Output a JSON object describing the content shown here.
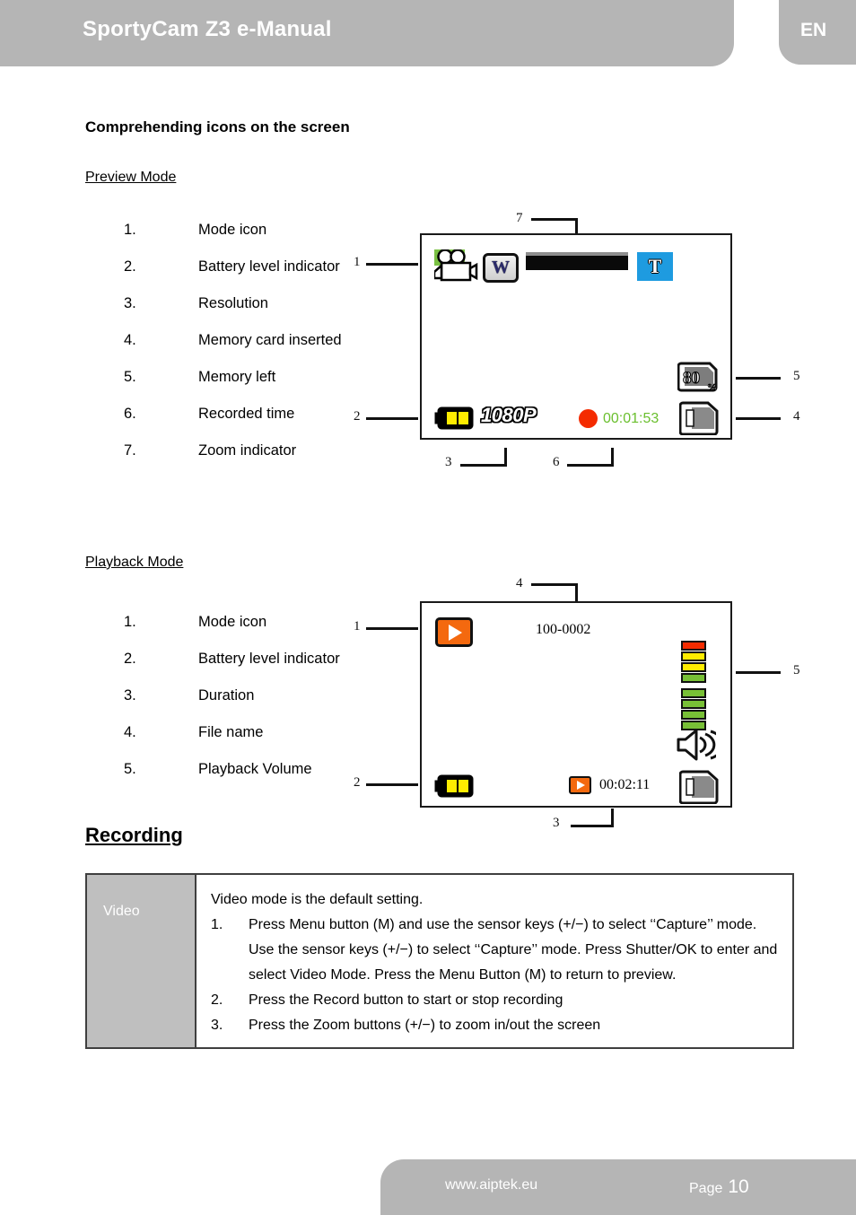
{
  "header": {
    "title": "SportyCam Z3 e-Manual",
    "language": "EN"
  },
  "content": {
    "section_title": "Comprehending icons on the screen",
    "preview_heading": "Preview Mode",
    "playback_heading": "Playback Mode",
    "recording_heading": "Recording"
  },
  "preview_list": [
    {
      "num": "1.",
      "label": "Mode icon"
    },
    {
      "num": "2.",
      "label": "Battery level indicator"
    },
    {
      "num": "3.",
      "label": "Resolution"
    },
    {
      "num": "4.",
      "label": "Memory card inserted"
    },
    {
      "num": "5.",
      "label": "Memory left"
    },
    {
      "num": "6.",
      "label": "Recorded time"
    },
    {
      "num": "7.",
      "label": "Zoom indicator"
    }
  ],
  "playback_list": [
    {
      "num": "1.",
      "label": "Mode icon"
    },
    {
      "num": "2.",
      "label": "Battery level indicator"
    },
    {
      "num": "3.",
      "label": "Duration"
    },
    {
      "num": "4.",
      "label": "File name"
    },
    {
      "num": "5.",
      "label": "Playback Volume"
    }
  ],
  "preview_screen": {
    "callouts": {
      "c1": "1",
      "c2": "2",
      "c3": "3",
      "c4": "4",
      "c5": "5",
      "c6": "6",
      "c7": "7"
    },
    "mode_icon": "camcorder-icon",
    "wide_icon_label": "W",
    "tele_icon_label": "T",
    "resolution": "1080P",
    "recorded_time": "00:01:53",
    "memory_left": "80",
    "memory_left_unit": "%",
    "memory_card_icon": "sd-card-icon",
    "record_dot_icon": "record-dot-icon",
    "battery_icon": "battery-icon",
    "zoom_bar_icon": "zoom-bar-icon"
  },
  "playback_screen": {
    "callouts": {
      "c1": "1",
      "c2": "2",
      "c3": "3",
      "c4": "4",
      "c5": "5"
    },
    "mode_icon": "play-icon",
    "file_name": "100-0002",
    "duration": "00:02:11",
    "battery_icon": "battery-icon",
    "memory_card_icon": "sd-card-icon",
    "speaker_icon": "speaker-icon",
    "volume_icon": "volume-bars-icon",
    "volume_segments": [
      "#f42b00",
      "#ffec00",
      "#ffec00",
      "#78c036",
      "#78c036",
      "#78c036",
      "#78c036",
      "#78c036"
    ]
  },
  "recording_table": {
    "row_label": "Video",
    "intro": "Video mode is the default setting.",
    "steps": [
      {
        "n": "1.",
        "text": "Press Menu button (M) and use the sensor keys (+/−) to select ‘‘Capture’’ mode. Use the sensor keys (+/−) to select ‘‘Capture’’ mode. Press Shutter/OK to enter and select Video Mode. Press the Menu Button (M) to return to preview."
      },
      {
        "n": "2.",
        "text": "Press the Record button to start or stop recording"
      },
      {
        "n": "3.",
        "text": "Press the Zoom buttons (+/−) to zoom in/out the screen"
      }
    ]
  },
  "footer": {
    "website": "www.aiptek.eu",
    "page_label": "Page",
    "page_number": "10"
  },
  "colors": {
    "header_gray": "#b5b5b5",
    "accent_orange": "#f4690f",
    "record_red": "#f42b00",
    "time_green": "#6abf2e",
    "tele_blue": "#1e9be0",
    "mode_green": "#7ac143",
    "battery_yellow": "#ffec00"
  }
}
